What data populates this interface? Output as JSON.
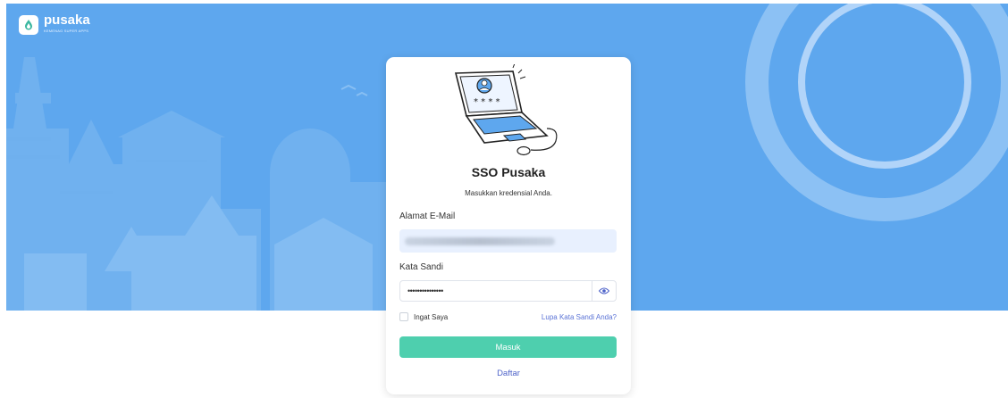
{
  "brand": {
    "name": "pusaka",
    "tagline": "KEMENAG SUPER APPS"
  },
  "card": {
    "title": "SSO Pusaka",
    "subtitle": "Masukkan kredensial Anda.",
    "email_label": "Alamat E-Mail",
    "password_label": "Kata Sandi",
    "password_mask": "•••••••••••••••",
    "remember_label": "Ingat Saya",
    "forgot_link": "Lupa Kata Sandi Anda?",
    "submit_label": "Masuk",
    "register_link": "Daftar",
    "illustration_text": "* * * *"
  },
  "colors": {
    "hero_bg": "#5ea7ee",
    "submit_bg": "#4ecfae",
    "link": "#5b73d6"
  },
  "icons": {
    "brand_logo": "drop-logo-icon",
    "password_toggle": "eye-icon"
  }
}
